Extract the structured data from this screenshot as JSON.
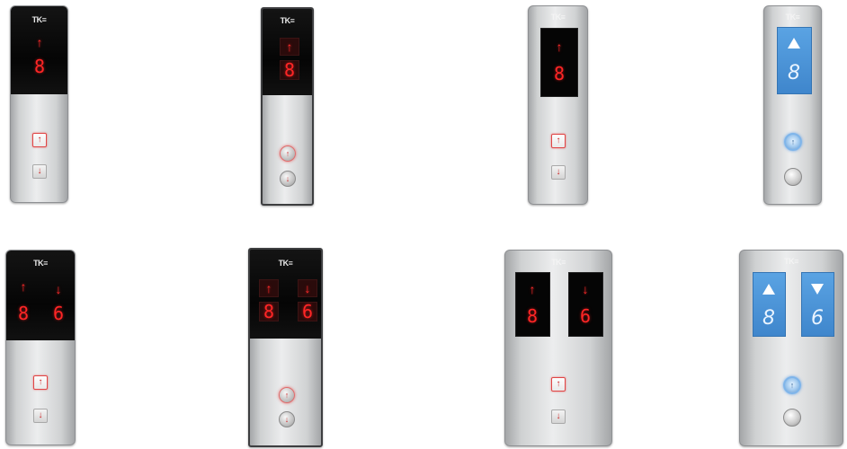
{
  "brand": "TK≡",
  "panels": {
    "p1": {
      "up_arrow": "↑",
      "floor": "8",
      "up_btn": "↑",
      "down_btn": "↓"
    },
    "p2": {
      "up_arrow": "↑",
      "floor": "8",
      "up_btn": "↑",
      "down_btn": "↓"
    },
    "p3": {
      "up_arrow": "↑",
      "floor": "8",
      "up_btn": "↑",
      "down_btn": "↓"
    },
    "p4": {
      "floor": "8",
      "up_btn": "↑"
    },
    "p5": {
      "up_arrow": "↑",
      "down_arrow": "↓",
      "floor_left": "8",
      "floor_right": "6",
      "up_btn": "↑",
      "down_btn": "↓"
    },
    "p6": {
      "up_arrow": "↑",
      "down_arrow": "↓",
      "floor_left": "8",
      "floor_right": "6",
      "up_btn": "↑",
      "down_btn": "↓"
    },
    "p7": {
      "up_arrow": "↑",
      "down_arrow": "↓",
      "floor_left": "8",
      "floor_right": "6",
      "up_btn": "↑",
      "down_btn": "↓"
    },
    "p8": {
      "floor_left": "8",
      "floor_right": "6",
      "up_btn": "↑"
    }
  },
  "colors": {
    "led_red": "#ff2626",
    "blue_display": "#4a93d8",
    "steel": "#d6d8d9"
  }
}
